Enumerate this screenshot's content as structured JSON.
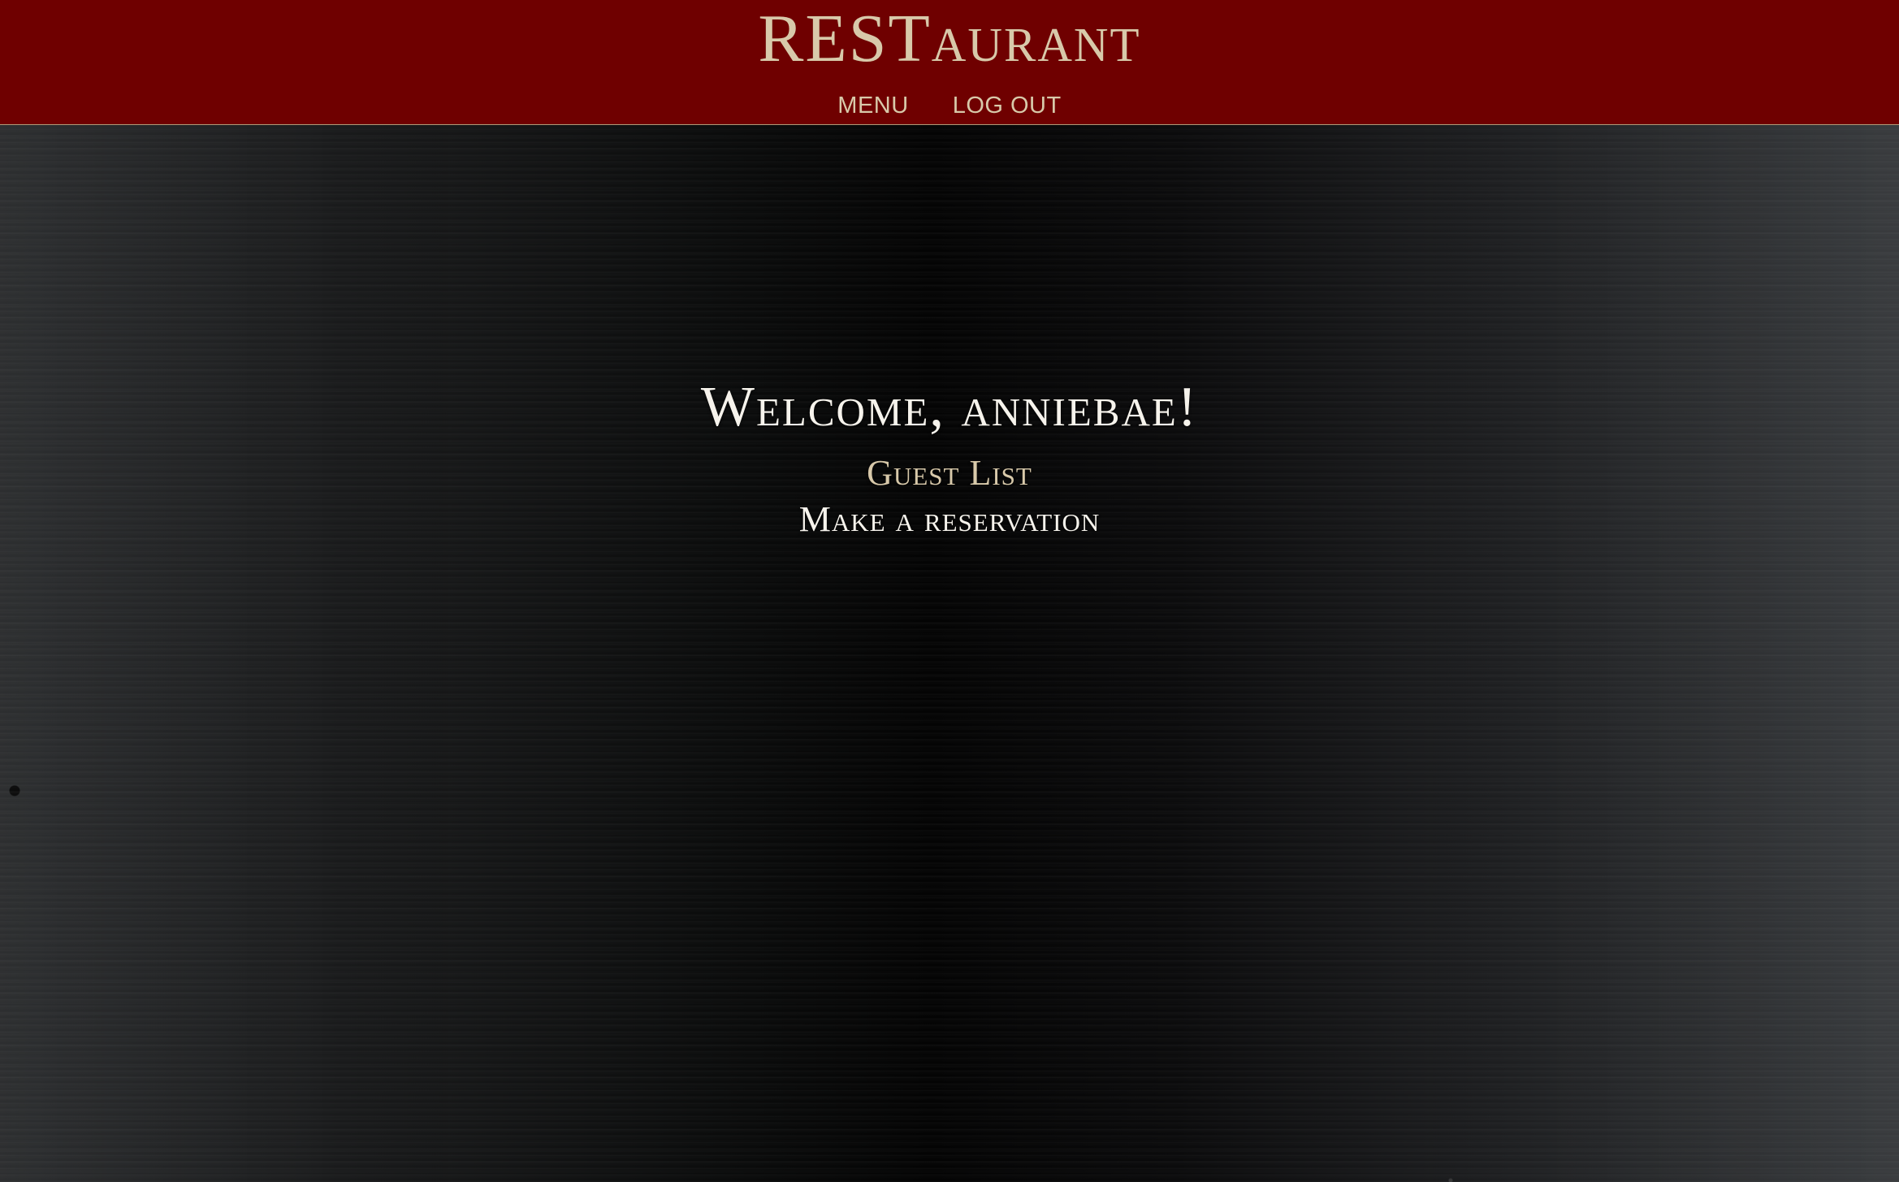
{
  "header": {
    "brand": "RESTaurant",
    "nav": [
      {
        "label": "MENU"
      },
      {
        "label": "LOG OUT"
      }
    ],
    "colors": {
      "background": "#6f0000",
      "text": "#d8c9aa"
    }
  },
  "main": {
    "welcome_text": "Welcome, anniebae!",
    "links": {
      "guest_list": "Guest List",
      "make_reservation": "Make a reservation"
    },
    "colors": {
      "primary_text": "#f6f3ec",
      "accent_text": "#d8c9aa"
    }
  }
}
